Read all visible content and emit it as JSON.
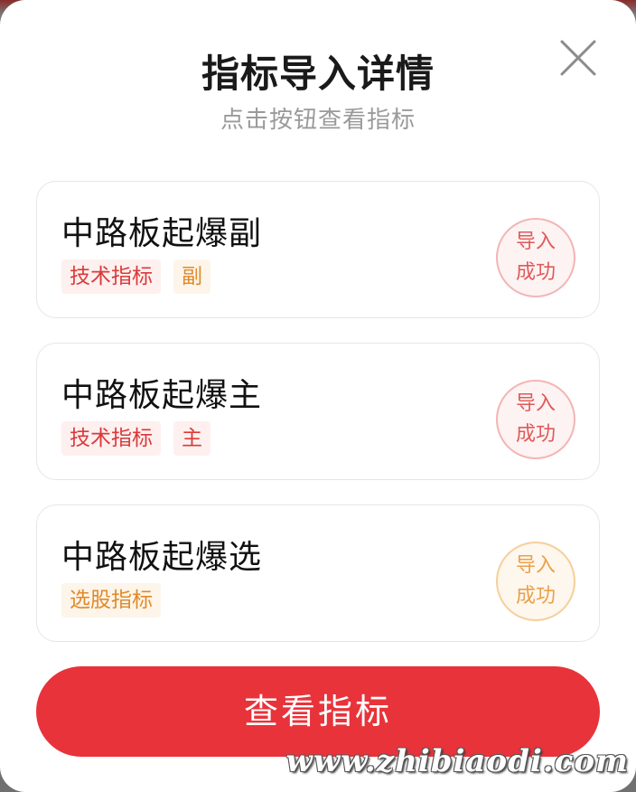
{
  "dialog": {
    "title": "指标导入详情",
    "subtitle": "点击按钮查看指标",
    "close_icon": "close-icon"
  },
  "indicators": [
    {
      "name": "中路板起爆副",
      "tags": [
        {
          "label": "技术指标",
          "color": "#d93a3a"
        },
        {
          "label": "副",
          "color": "#e08a2a"
        }
      ],
      "status_line1": "导入",
      "status_line2": "成功",
      "status_color": "#e05a5a"
    },
    {
      "name": "中路板起爆主",
      "tags": [
        {
          "label": "技术指标",
          "color": "#d93a3a"
        },
        {
          "label": "主",
          "color": "#d93a3a"
        }
      ],
      "status_line1": "导入",
      "status_line2": "成功",
      "status_color": "#e05a5a"
    },
    {
      "name": "中路板起爆选",
      "tags": [
        {
          "label": "选股指标",
          "color": "#e08a2a"
        }
      ],
      "status_line1": "导入",
      "status_line2": "成功",
      "status_color": "#eba04a"
    }
  ],
  "primary_button": {
    "label": "查看指标",
    "color": "#e8333a"
  },
  "watermark": "www.zhibiaodi.com"
}
